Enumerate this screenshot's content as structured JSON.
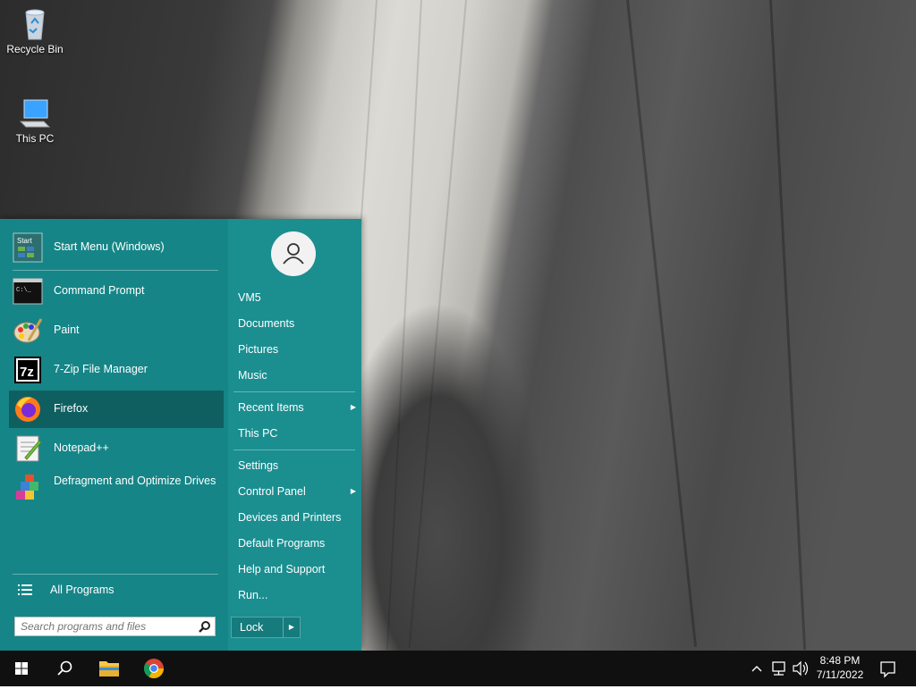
{
  "desktop": {
    "icons": [
      {
        "label": "Recycle Bin",
        "icon": "recycle-bin-icon"
      },
      {
        "label": "This PC",
        "icon": "this-pc-icon"
      }
    ]
  },
  "start_menu": {
    "programs": [
      {
        "label": "Start Menu (Windows)",
        "icon": "start-menu-icon",
        "selected": false
      },
      {
        "label": "Command Prompt",
        "icon": "command-prompt-icon",
        "selected": false
      },
      {
        "label": "Paint",
        "icon": "paint-icon",
        "selected": false
      },
      {
        "label": "7-Zip File Manager",
        "icon": "7zip-icon",
        "selected": false
      },
      {
        "label": "Firefox",
        "icon": "firefox-icon",
        "selected": true
      },
      {
        "label": "Notepad++",
        "icon": "notepad-plus-plus-icon",
        "selected": false
      },
      {
        "label": "Defragment and Optimize Drives",
        "icon": "defragment-icon",
        "selected": false
      }
    ],
    "all_programs_label": "All Programs",
    "search_placeholder": "Search programs and files",
    "start_icon_text": "Start",
    "cmd_icon_text": "C:\\_",
    "zip_icon_text": "7z",
    "right_items": [
      {
        "label": "VM5",
        "arrow": false
      },
      {
        "label": "Documents",
        "arrow": false
      },
      {
        "label": "Pictures",
        "arrow": false
      },
      {
        "label": "Music",
        "arrow": false
      },
      {
        "label": "Recent Items",
        "arrow": true
      },
      {
        "label": "This PC",
        "arrow": false
      },
      {
        "label": "Settings",
        "arrow": false
      },
      {
        "label": "Control Panel",
        "arrow": true
      },
      {
        "label": "Devices and Printers",
        "arrow": false
      },
      {
        "label": "Default Programs",
        "arrow": false
      },
      {
        "label": "Help and Support",
        "arrow": false
      },
      {
        "label": "Run...",
        "arrow": false
      }
    ],
    "lock_label": "Lock",
    "arrow_glyph": "▶"
  },
  "taskbar": {
    "time": "8:48 PM",
    "date": "7/11/2022",
    "pinned": [
      "start-button",
      "search-icon",
      "file-explorer-icon",
      "chrome-icon"
    ],
    "tray": [
      "chevron-up-icon",
      "network-icon",
      "volume-icon",
      "notifications-icon"
    ]
  },
  "colors": {
    "start_menu": "#1c8c8e",
    "start_menu_left": "#168587",
    "selected_item": "#0f5f61",
    "taskbar": "#101010"
  }
}
